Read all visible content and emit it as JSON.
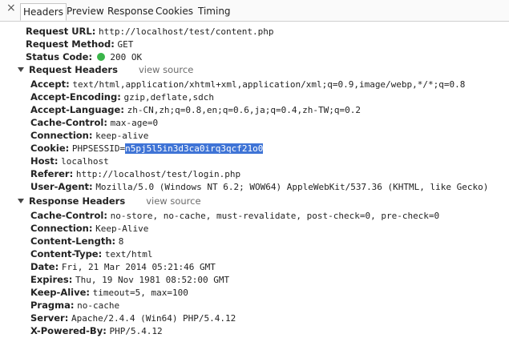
{
  "tabs": [
    "Headers",
    "Preview",
    "Response",
    "Cookies",
    "Timing"
  ],
  "close_glyph": "×",
  "general": {
    "url_key": "Request URL:",
    "url_val": "http://localhost/test/content.php",
    "method_key": "Request Method:",
    "method_val": "GET",
    "status_key": "Status Code:",
    "status_val": "200 OK",
    "status_color": "#3ab54a"
  },
  "request": {
    "title": "Request Headers",
    "view_source": "view source",
    "headers": [
      {
        "key": "Accept:",
        "value": "text/html,application/xhtml+xml,application/xml;q=0.9,image/webp,*/*;q=0.8"
      },
      {
        "key": "Accept-Encoding:",
        "value": "gzip,deflate,sdch"
      },
      {
        "key": "Accept-Language:",
        "value": "zh-CN,zh;q=0.8,en;q=0.6,ja;q=0.4,zh-TW;q=0.2"
      },
      {
        "key": "Cache-Control:",
        "value": "max-age=0"
      },
      {
        "key": "Connection:",
        "value": "keep-alive"
      },
      {
        "key": "Cookie:",
        "value_prefix": "PHPSESSID=",
        "value_selected": "n5pj5l5in3d3ca0irq3qcf21o0"
      },
      {
        "key": "Host:",
        "value": "localhost"
      },
      {
        "key": "Referer:",
        "value": "http://localhost/test/login.php"
      },
      {
        "key": "User-Agent:",
        "value": "Mozilla/5.0 (Windows NT 6.2; WOW64) AppleWebKit/537.36 (KHTML, like Gecko)"
      }
    ]
  },
  "response": {
    "title": "Response Headers",
    "view_source": "view source",
    "headers": [
      {
        "key": "Cache-Control:",
        "value": "no-store, no-cache, must-revalidate, post-check=0, pre-check=0"
      },
      {
        "key": "Connection:",
        "value": "Keep-Alive"
      },
      {
        "key": "Content-Length:",
        "value": "8"
      },
      {
        "key": "Content-Type:",
        "value": "text/html"
      },
      {
        "key": "Date:",
        "value": "Fri, 21 Mar 2014 05:21:46 GMT"
      },
      {
        "key": "Expires:",
        "value": "Thu, 19 Nov 1981 08:52:00 GMT"
      },
      {
        "key": "Keep-Alive:",
        "value": "timeout=5, max=100"
      },
      {
        "key": "Pragma:",
        "value": "no-cache"
      },
      {
        "key": "Server:",
        "value": "Apache/2.4.4 (Win64) PHP/5.4.12"
      },
      {
        "key": "X-Powered-By:",
        "value": "PHP/5.4.12"
      }
    ]
  },
  "colors": {
    "selection": "#3f74d6",
    "tab_border": "#c6c6c6"
  }
}
